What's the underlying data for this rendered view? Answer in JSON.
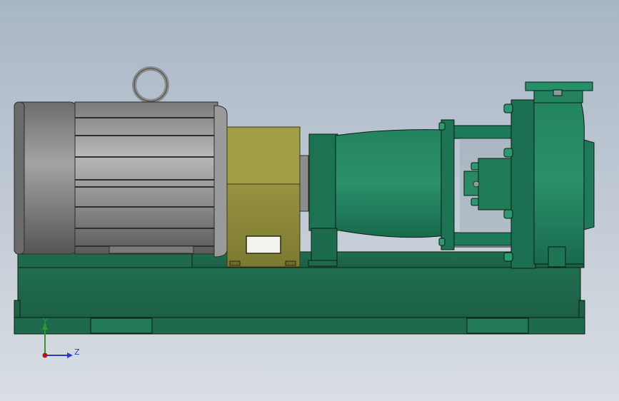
{
  "model": {
    "description_hidden": true,
    "colors": {
      "background_top": "#a9b6c6",
      "background_bottom": "#d9dee4",
      "base_green": "#1f6a4c",
      "base_green_dark": "#134a33",
      "pump_green": "#1d7a58",
      "pump_green_light": "#2a8f68",
      "motor_gray": "#9a9a9a",
      "motor_gray_dark": "#5c5c5c",
      "coupling_olive": "#8f8c3c",
      "edge": "#0c1c14"
    }
  },
  "triad": {
    "y_label": "Y",
    "z_label": "Z",
    "y_color": "#2e9a2e",
    "z_color": "#2b3fb8",
    "x_color": "#b31616"
  }
}
